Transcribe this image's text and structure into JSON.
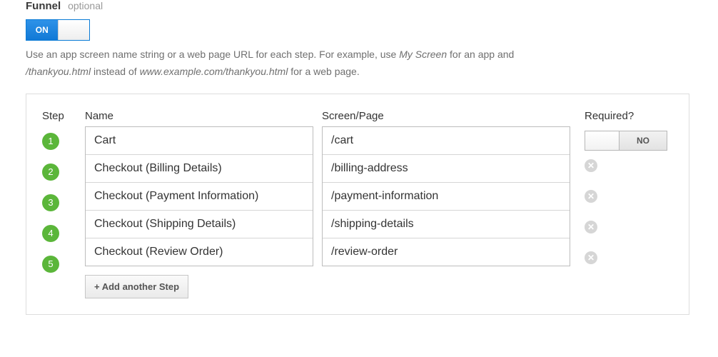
{
  "section": {
    "title": "Funnel",
    "optional_label": "optional"
  },
  "toggle": {
    "on_label": "ON"
  },
  "helptext": {
    "p1a": "Use an app screen name string or a web page URL for each step. For example, use ",
    "p1_em": "My Screen",
    "p1b": " for an app and ",
    "p2_em": "/thankyou.html",
    "p2a": " instead of ",
    "p2_em2": "www.example.com/thankyou.html",
    "p2b": " for a web page."
  },
  "headers": {
    "step": "Step",
    "name": "Name",
    "page": "Screen/Page",
    "required": "Required?"
  },
  "required_toggle": {
    "no_label": "NO"
  },
  "steps": [
    {
      "num": "1",
      "name": "Cart",
      "page": "/cart"
    },
    {
      "num": "2",
      "name": "Checkout (Billing Details)",
      "page": "/billing-address"
    },
    {
      "num": "3",
      "name": "Checkout (Payment Information)",
      "page": "/payment-information"
    },
    {
      "num": "4",
      "name": "Checkout (Shipping Details)",
      "page": "/shipping-details"
    },
    {
      "num": "5",
      "name": "Checkout (Review Order)",
      "page": "/review-order"
    }
  ],
  "add_button": "+ Add another Step"
}
